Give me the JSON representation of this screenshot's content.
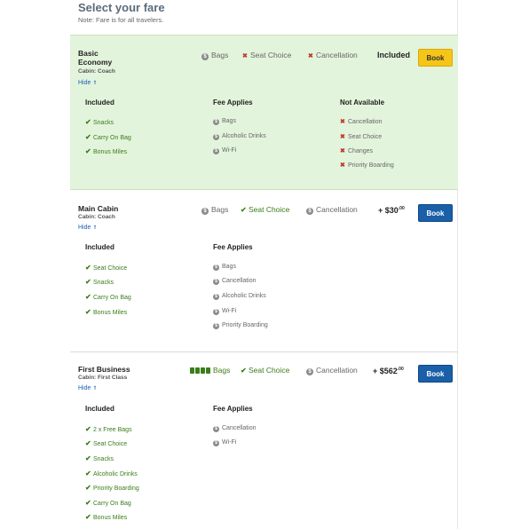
{
  "page": {
    "title": "Select your fare",
    "note": "Note: Fare is for all travelers."
  },
  "fares": [
    {
      "name_line1": "Basic",
      "name_line2": "Economy",
      "cabin": "Cabin: Coach",
      "hide_label": "Hide",
      "features": [
        "Bags",
        "Seat Choice",
        "Cancellation"
      ],
      "price_label": "Included",
      "book_label": "Book",
      "columns": [
        {
          "heading": "Included",
          "items": [
            "Snacks",
            "Carry On Bag",
            "Bonus Miles"
          ]
        },
        {
          "heading": "Fee Applies",
          "items": [
            "Bags",
            "Alcoholic Drinks",
            "Wi-Fi"
          ]
        },
        {
          "heading": "Not Available",
          "items": [
            "Cancellation",
            "Seat Choice",
            "Changes",
            "Priority Boarding"
          ]
        }
      ]
    },
    {
      "name_line1": "Main Cabin",
      "cabin": "Cabin: Coach",
      "hide_label": "Hide",
      "features": [
        "Bags",
        "Seat Choice",
        "Cancellation"
      ],
      "price_main": "+ $30",
      "price_cents": ".00",
      "book_label": "Book",
      "columns": [
        {
          "heading": "Included",
          "items": [
            "Seat Choice",
            "Snacks",
            "Carry On Bag",
            "Bonus Miles"
          ]
        },
        {
          "heading": "Fee Applies",
          "items": [
            "Bags",
            "Cancellation",
            "Alcoholic Drinks",
            "Wi-Fi",
            "Priority Boarding"
          ]
        }
      ]
    },
    {
      "name_line1": "First Business",
      "cabin": "Cabin: First Class",
      "hide_label": "Hide",
      "features": [
        "Bags",
        "Seat Choice",
        "Cancellation"
      ],
      "price_main": "+ $562",
      "price_cents": ".00",
      "book_label": "Book",
      "columns": [
        {
          "heading": "Included",
          "items": [
            "2 x Free Bags",
            "Seat Choice",
            "Snacks",
            "Alcoholic Drinks",
            "Priority Boarding",
            "Carry On Bag",
            "Bonus Miles"
          ]
        },
        {
          "heading": "Fee Applies",
          "items": [
            "Cancellation",
            "Wi-Fi"
          ]
        }
      ]
    }
  ],
  "colors": {
    "included_green": "#3a7d1a",
    "unavailable_red": "#c0392b",
    "selected_bg": "#e3f4dc",
    "book_yellow": "#f5c518",
    "book_blue": "#1a5fa8",
    "link_blue": "#1a5fb4"
  },
  "icons": {
    "included": "checkmark-icon",
    "not_available": "x-icon",
    "fee": "dollar-circle-icon",
    "bag": "bag-icon",
    "hide": "chevron-up-icon"
  }
}
